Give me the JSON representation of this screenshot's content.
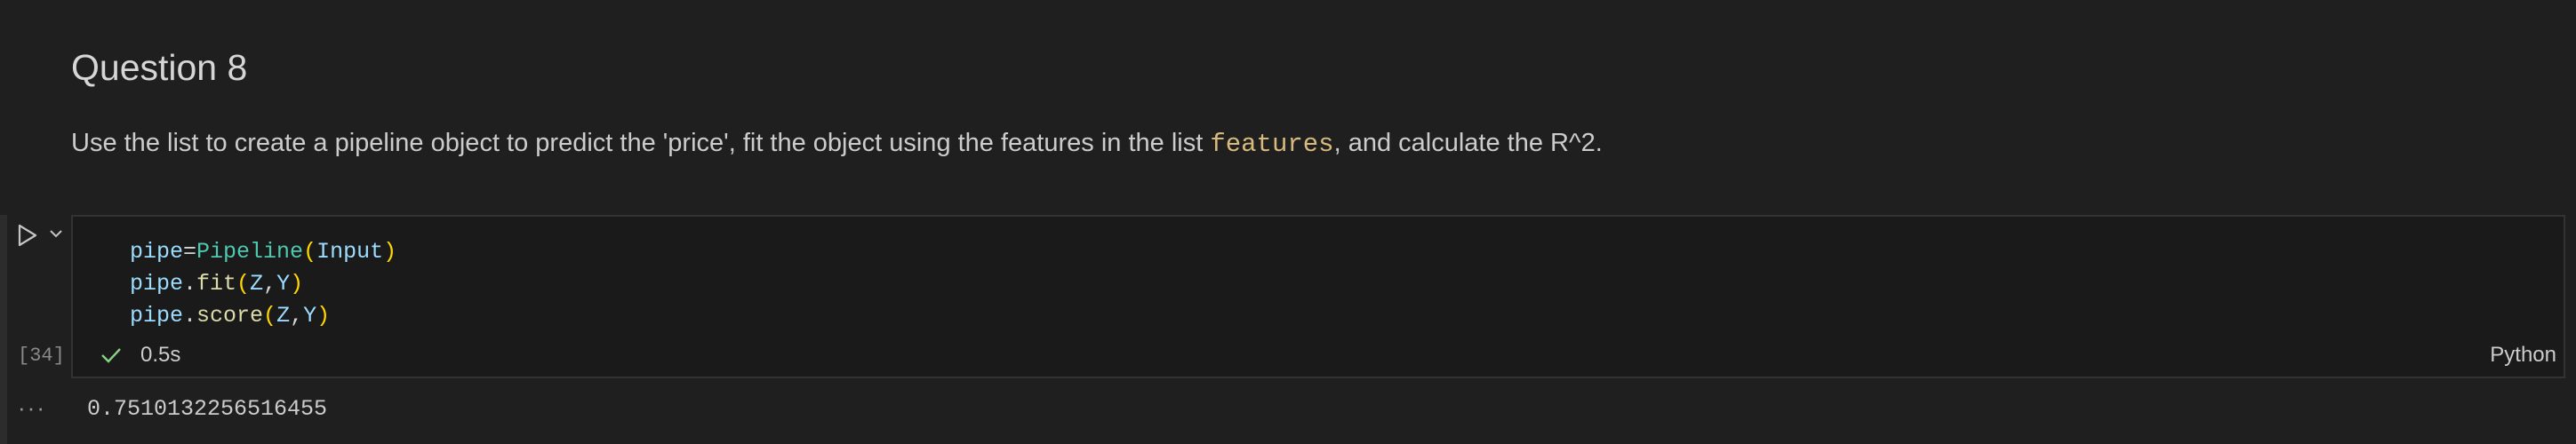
{
  "markdown_cell": {
    "title": "Question 8",
    "paragraph_before": "Use the list to create a pipeline object to predict the 'price', fit the object using the features in the list ",
    "inline_code": "features",
    "paragraph_after": ", and calculate the R^2."
  },
  "code_cell": {
    "execution_count": "[34]",
    "lines": [
      {
        "var": "pipe",
        "op": "=",
        "call": "Pipeline",
        "args": "Input"
      },
      {
        "obj": "pipe",
        "method": "fit",
        "arg1": "Z",
        "arg2": "Y"
      },
      {
        "obj": "pipe",
        "method": "score",
        "arg1": "Z",
        "arg2": "Y"
      }
    ],
    "status_duration": "0.5s",
    "language": "Python",
    "run_icon": "play-icon",
    "menu_icon": "chevron-down-icon",
    "status_icon": "check-icon"
  },
  "output": {
    "ellipsis": "···",
    "value": "0.7510132256516455"
  },
  "colors": {
    "background": "#1f1f1f",
    "success": "#89d185",
    "string_code": "#d7ba7d"
  }
}
